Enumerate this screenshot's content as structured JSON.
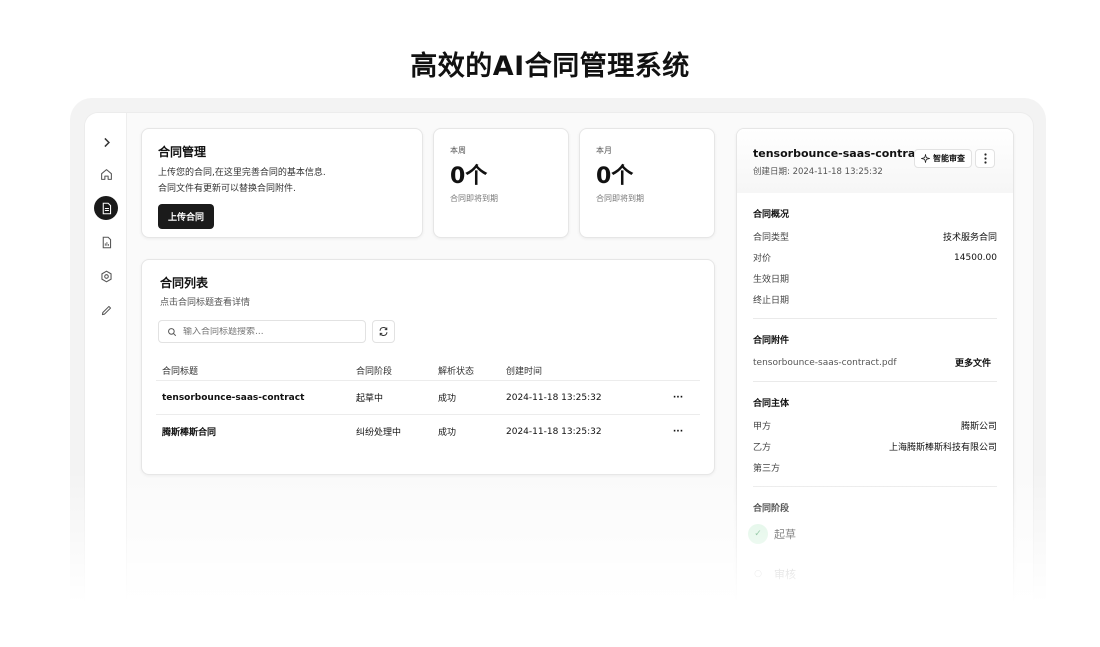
{
  "page_title": "高效的AI合同管理系统",
  "sidebar": {
    "items": [
      {
        "icon": "chevron-right-icon"
      },
      {
        "icon": "home-icon"
      },
      {
        "icon": "document-icon",
        "active": true
      },
      {
        "icon": "report-icon"
      },
      {
        "icon": "settings-icon"
      },
      {
        "icon": "pencil-icon"
      }
    ]
  },
  "management_card": {
    "title": "合同管理",
    "description": "上传您的合同,在这里完善合同的基本信息.合同文件有更新可以替换合同附件.",
    "upload_label": "上传合同"
  },
  "stats": [
    {
      "label": "本周",
      "value": "0个",
      "sub": "合同即将到期"
    },
    {
      "label": "本月",
      "value": "0个",
      "sub": "合同即将到期"
    }
  ],
  "contract_list": {
    "title": "合同列表",
    "subtitle": "点击合同标题查看详情",
    "search_placeholder": "输入合同标题搜索...",
    "columns": [
      "合同标题",
      "合同阶段",
      "解析状态",
      "创建时间"
    ],
    "rows": [
      {
        "title": "tensorbounce-saas-contract",
        "stage": "起草中",
        "status": "成功",
        "created": "2024-11-18 13:25:32",
        "more": "···"
      },
      {
        "title": "腾斯棒斯合同",
        "stage": "纠纷处理中",
        "status": "成功",
        "created": "2024-11-18 13:25:32",
        "more": "···"
      }
    ]
  },
  "detail": {
    "title": "tensorbounce-saas-contract",
    "created": "创建日期: 2024-11-18 13:25:32",
    "ai_review_label": "智能审查",
    "overview": {
      "heading": "合同概况",
      "items": [
        {
          "key": "合同类型",
          "value": "技术服务合同"
        },
        {
          "key": "对价",
          "value": "14500.00"
        },
        {
          "key": "生效日期",
          "value": ""
        },
        {
          "key": "终止日期",
          "value": ""
        }
      ]
    },
    "attachments": {
      "heading": "合同附件",
      "file": "tensorbounce-saas-contract.pdf",
      "more_label": "更多文件"
    },
    "parties": {
      "heading": "合同主体",
      "items": [
        {
          "key": "甲方",
          "value": "腾斯公司"
        },
        {
          "key": "乙方",
          "value": "上海腾斯棒斯科技有限公司"
        },
        {
          "key": "第三方",
          "value": ""
        }
      ]
    },
    "stages": {
      "heading": "合同阶段",
      "items": [
        {
          "label": "起草",
          "done": true
        },
        {
          "label": "审核",
          "done": false
        }
      ]
    }
  }
}
